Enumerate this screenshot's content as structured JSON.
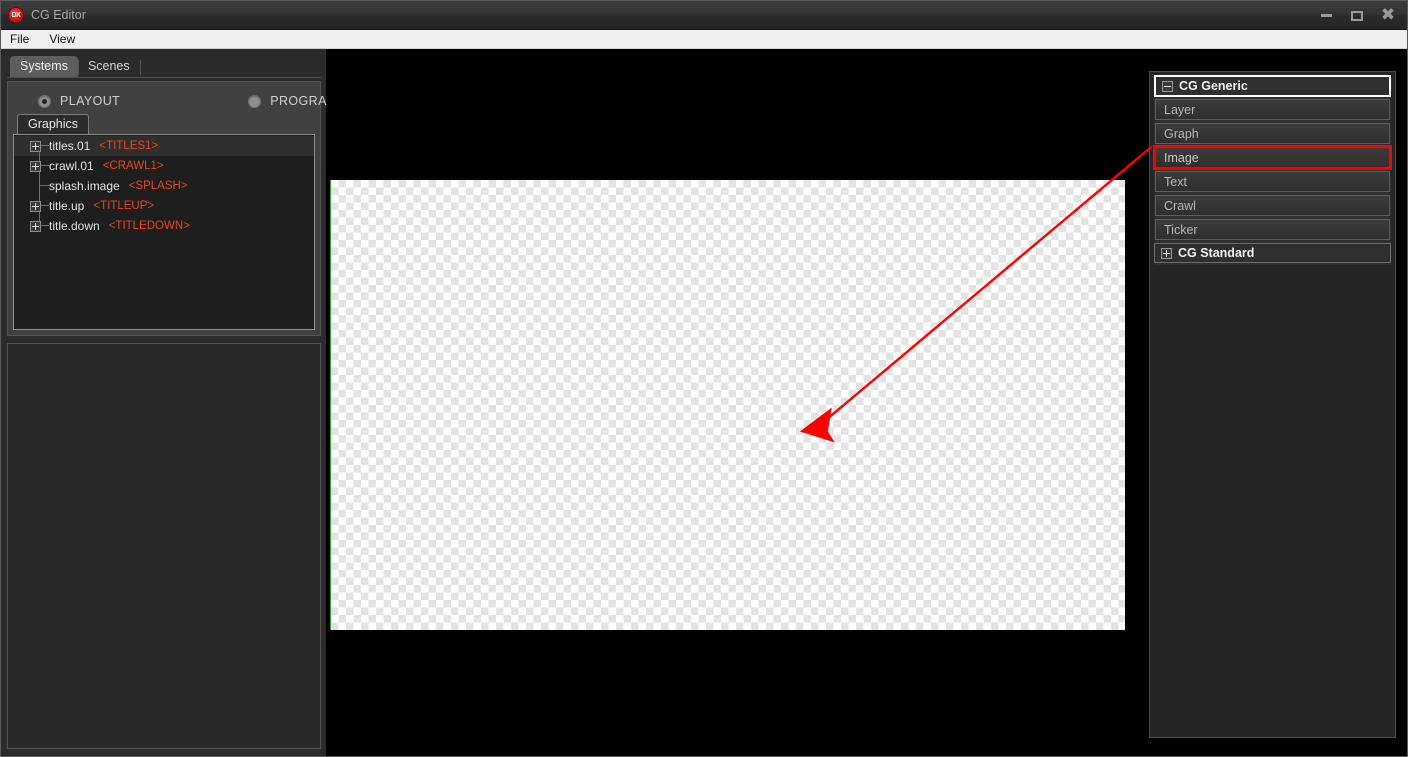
{
  "window": {
    "title": "CG Editor",
    "app_icon": "dx-logo-icon",
    "minimize_label": "Minimize",
    "maximize_label": "Restore",
    "close_label": "Close"
  },
  "menubar": {
    "items": [
      {
        "label": "File"
      },
      {
        "label": "View"
      }
    ]
  },
  "left_panel": {
    "tabs": [
      {
        "label": "Systems",
        "active": true
      },
      {
        "label": "Scenes",
        "active": false
      }
    ],
    "mode_options": [
      {
        "label": "PLAYOUT",
        "selected": true
      },
      {
        "label": "PROGRAM",
        "selected": false
      }
    ],
    "sub_tab": {
      "label": "Graphics"
    },
    "tree_items": [
      {
        "name": "titles.01",
        "tag": "<TITLES1>",
        "expandable": true,
        "selected": true
      },
      {
        "name": "crawl.01",
        "tag": "<CRAWL1>",
        "expandable": true,
        "selected": false
      },
      {
        "name": "splash.image",
        "tag": "<SPLASH>",
        "expandable": false,
        "selected": false
      },
      {
        "name": "title.up",
        "tag": "<TITLEUP>",
        "expandable": true,
        "selected": false
      },
      {
        "name": "title.down",
        "tag": "<TITLEDOWN>",
        "expandable": true,
        "selected": false
      }
    ]
  },
  "right_panel": {
    "groups": [
      {
        "title": "CG Generic",
        "state": "expanded",
        "toggle_icon": "minus-box-icon",
        "items": [
          {
            "label": "Layer",
            "highlighted": false
          },
          {
            "label": "Graph",
            "highlighted": false
          },
          {
            "label": "Image",
            "highlighted": true
          },
          {
            "label": "Text",
            "highlighted": false
          },
          {
            "label": "Crawl",
            "highlighted": false
          },
          {
            "label": "Ticker",
            "highlighted": false
          }
        ]
      },
      {
        "title": "CG Standard",
        "state": "collapsed",
        "toggle_icon": "plus-box-icon",
        "items": []
      }
    ]
  },
  "annotation": {
    "color": "#ff0000",
    "type": "arrow",
    "from_label": "Image",
    "to_label": "preview-canvas"
  },
  "preview": {
    "background": "#000000",
    "canvas_type": "transparent-checkerboard",
    "edge_marker_color": "#2aa12a"
  }
}
